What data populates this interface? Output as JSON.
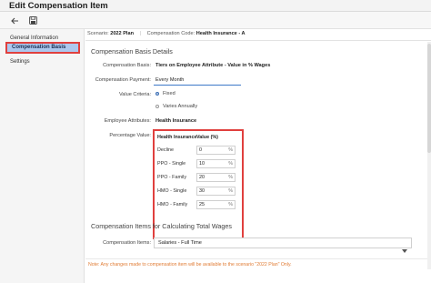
{
  "window": {
    "title": "Edit Compensation Item"
  },
  "toolbar": {
    "back_icon": "back-arrow-icon",
    "save_icon": "save-icon"
  },
  "sidebar": {
    "items": [
      {
        "label": "General Information"
      },
      {
        "label": "Compensation Basis"
      },
      {
        "label": "Settings"
      }
    ]
  },
  "header": {
    "scenario_label": "Scenario:",
    "scenario_value": "2022 Plan",
    "code_label": "Compensation Code:",
    "code_value": "Health Insurance - A"
  },
  "basis": {
    "section_title": "Compensation Basis Details",
    "basis_label": "Compensation Basis:",
    "basis_value": "Tiers on Employee Attribute - Value in % Wages",
    "payment_label": "Compensation Payment:",
    "payment_value": "Every Month",
    "criteria_label": "Value Criteria:",
    "criteria_options": [
      {
        "label": "Fixed",
        "selected": true
      },
      {
        "label": "Varies Annually",
        "selected": false
      }
    ],
    "attributes_label": "Employee Attributes:",
    "attributes_value": "Health Insurance",
    "percentage_label": "Percentage Value:",
    "table": {
      "col1": "Health Insurance",
      "col2": "Value (%)",
      "unit": "%",
      "rows": [
        {
          "name": "Decline",
          "value": "0"
        },
        {
          "name": "PPO - Single",
          "value": "10"
        },
        {
          "name": "PPO - Family",
          "value": "20"
        },
        {
          "name": "HMO - Single",
          "value": "30"
        },
        {
          "name": "HMO - Family",
          "value": "25"
        }
      ]
    }
  },
  "wages": {
    "section_title": "Compensation Items for Calculating Total Wages",
    "items_label": "Compensation Items:",
    "items_value": "Salaries - Full Time"
  },
  "note": "Note: Any changes made to compensation item will be available to the scenario \"2022 Plan\" Only.",
  "colors": {
    "accent": "#3c78c8",
    "highlight": "#e0403e",
    "active_nav": "#adc8ee",
    "note": "#e07b33"
  }
}
